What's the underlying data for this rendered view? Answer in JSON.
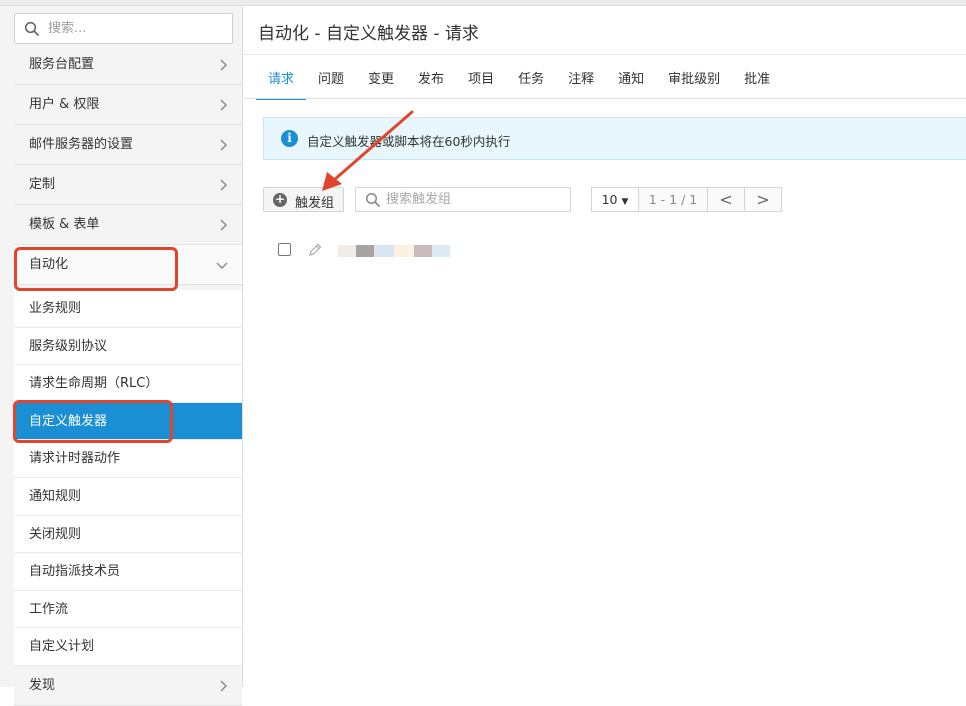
{
  "sidebar": {
    "search_placeholder": "搜索...",
    "menu": [
      {
        "label": "服务台配置"
      },
      {
        "label": "用户 & 权限"
      },
      {
        "label": "邮件服务器的设置"
      },
      {
        "label": "定制"
      },
      {
        "label": "模板 & 表单"
      },
      {
        "label": "自动化"
      }
    ],
    "submenu": [
      {
        "label": "业务规则"
      },
      {
        "label": "服务级别协议"
      },
      {
        "label": "请求生命周期（RLC）"
      },
      {
        "label": "自定义触发器"
      },
      {
        "label": "请求计时器动作"
      },
      {
        "label": "通知规则"
      },
      {
        "label": "关闭规则"
      },
      {
        "label": "自动指派技术员"
      },
      {
        "label": "工作流"
      },
      {
        "label": "自定义计划"
      }
    ],
    "after_submenu": {
      "label": "发现"
    },
    "active_submenu": "自定义触发器"
  },
  "main": {
    "title": "自动化 - 自定义触发器 - 请求",
    "tabs": [
      {
        "label": "请求"
      },
      {
        "label": "问题"
      },
      {
        "label": "变更"
      },
      {
        "label": "发布"
      },
      {
        "label": "项目"
      },
      {
        "label": "任务"
      },
      {
        "label": "注释"
      },
      {
        "label": "通知"
      },
      {
        "label": "审批级别"
      },
      {
        "label": "批准"
      }
    ],
    "active_tab": "请求",
    "info_text": "自定义触发器或脚本将在60秒内执行",
    "add_group_label": "触发组",
    "group_search_placeholder": "搜索触发组",
    "pager": {
      "page_size": "10",
      "range": "1 - 1 / 1",
      "prev": "<",
      "next": ">"
    }
  },
  "colors": {
    "accent": "#1a8fd4",
    "annotation_red": "#e0452e",
    "info_bg": "#e8f6fd"
  }
}
